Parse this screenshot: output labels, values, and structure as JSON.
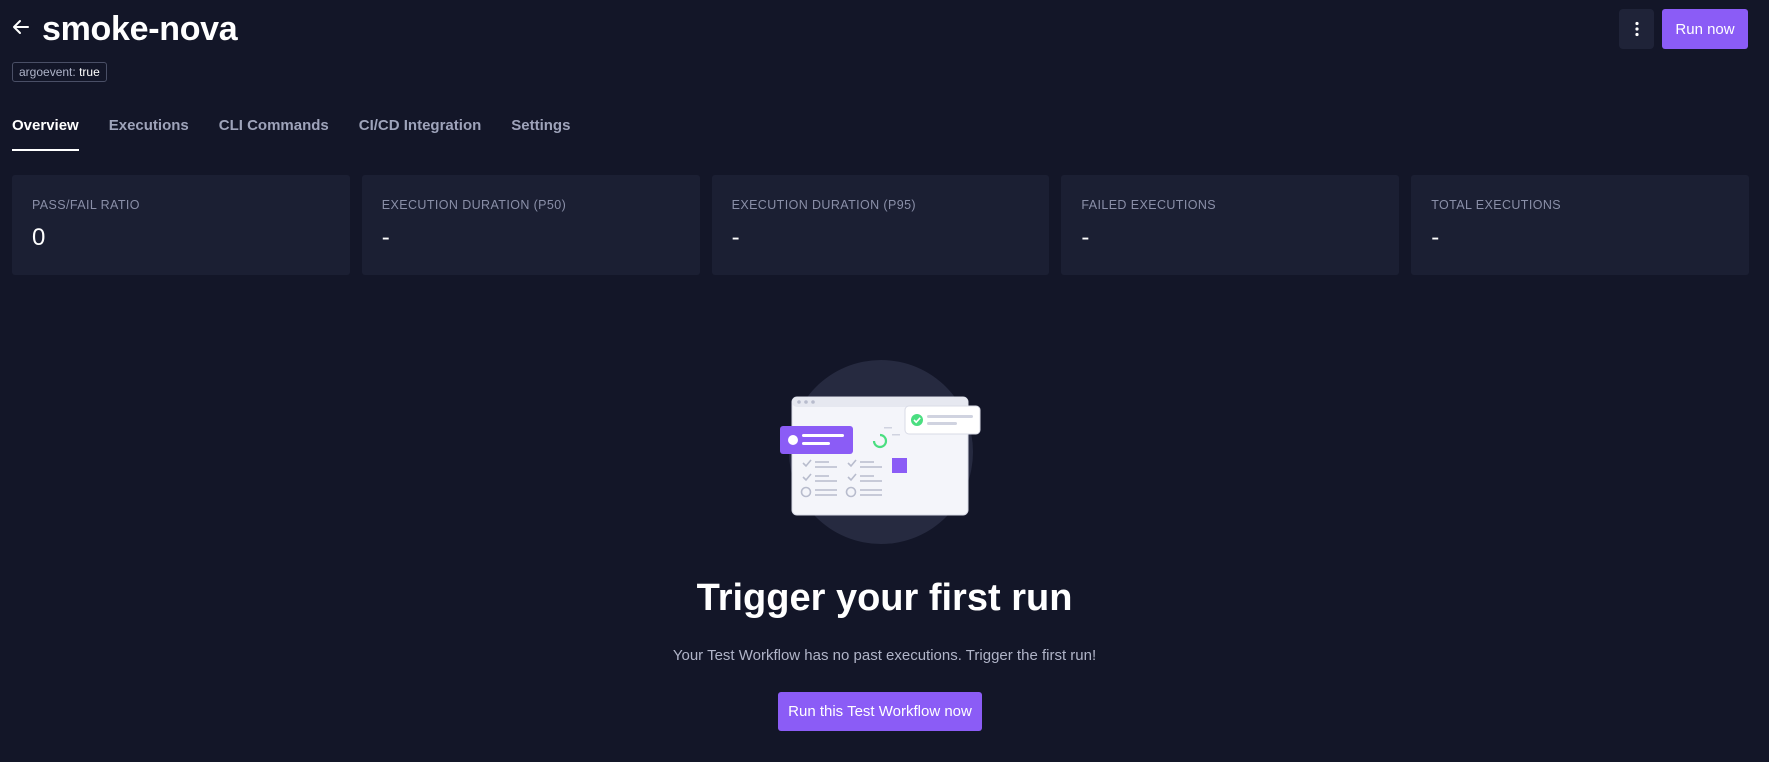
{
  "header": {
    "title": "smoke-nova",
    "label_key": "argoevent:",
    "label_value": "true",
    "run_button": "Run now",
    "more_icon": "more-vertical-icon",
    "back_icon": "arrow-left-icon"
  },
  "tabs": [
    {
      "label": "Overview",
      "active": true
    },
    {
      "label": "Executions",
      "active": false
    },
    {
      "label": "CLI Commands",
      "active": false
    },
    {
      "label": "CI/CD Integration",
      "active": false
    },
    {
      "label": "Settings",
      "active": false
    }
  ],
  "stats": [
    {
      "label": "PASS/FAIL RATIO",
      "value": "0"
    },
    {
      "label": "EXECUTION DURATION (P50)",
      "value": "-"
    },
    {
      "label": "EXECUTION DURATION (P95)",
      "value": "-"
    },
    {
      "label": "FAILED EXECUTIONS",
      "value": "-"
    },
    {
      "label": "TOTAL EXECUTIONS",
      "value": "-"
    }
  ],
  "empty_state": {
    "title": "Trigger your first run",
    "subtitle": "Your Test Workflow has no past executions. Trigger the first run!",
    "button": "Run this Test Workflow now"
  },
  "colors": {
    "background": "#131628",
    "card": "#1b1f33",
    "accent": "#8b5cf6",
    "success": "#4ade80"
  }
}
